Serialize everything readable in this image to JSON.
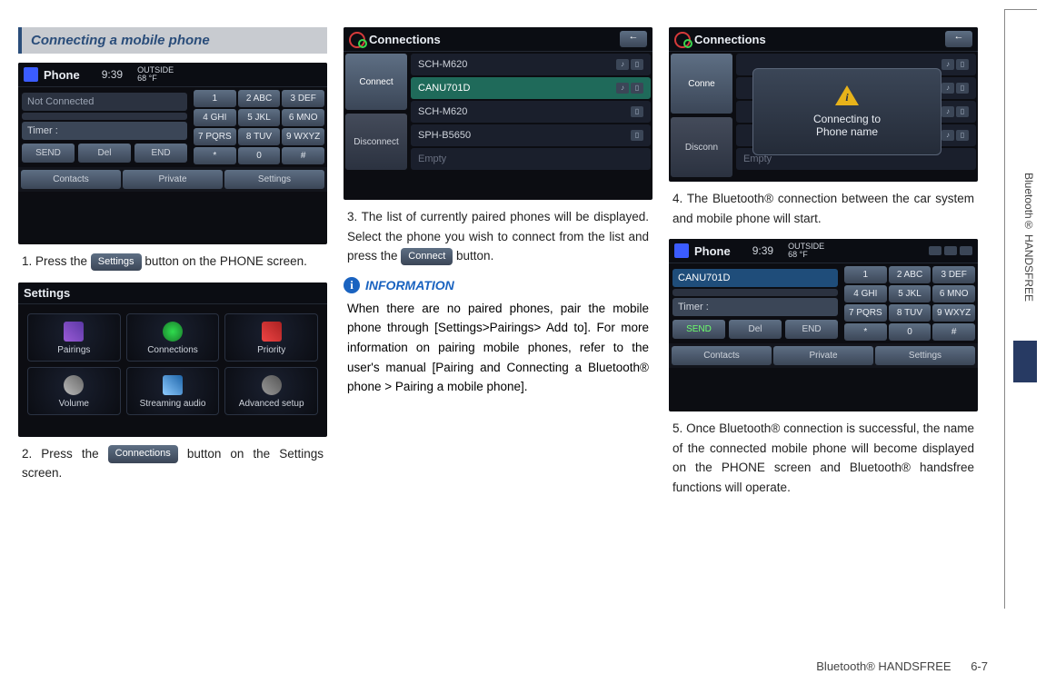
{
  "header": {
    "title": "Connecting a mobile phone"
  },
  "steps": {
    "s1a": "1. Press the ",
    "s1b": " button on the PHONE screen.",
    "s2a": "2. Press the ",
    "s2b": " button on the Settings screen.",
    "s3a": "3. The list of currently paired phones will be displayed. Select the phone you wish to connect from the list and press the ",
    "s3b": " button.",
    "s4": "4. The Bluetooth® connection between the car system and mobile phone will start.",
    "s5": "5. Once Bluetooth® connection is successful, the name of the connected mobile phone will become displayed on the PHONE screen and Bluetooth® handsfree functions will operate."
  },
  "chips": {
    "settings": "Settings",
    "connections": "Connections",
    "connect": "Connect"
  },
  "info": {
    "label": "INFORMATION",
    "icon": "i",
    "body": "When there are no paired phones, pair the mobile phone through [Settings>Pairings> Add to]. For more information on pairing mobile phones, refer to the user's manual [Pairing and Connecting a Bluetooth® phone > Pairing a mobile phone]."
  },
  "phoneScreen": {
    "title": "Phone",
    "time": "9:39",
    "tempTop": "OUTSIDE",
    "temp": "68 °F",
    "notConnected": "Not Connected",
    "timer": "Timer :",
    "keys": [
      "1",
      "2 ABC",
      "3 DEF",
      "4 GHI",
      "5 JKL",
      "6 MNO",
      "7 PQRS",
      "8 TUV",
      "9 WXYZ",
      "*",
      "0",
      "#"
    ],
    "send": "SEND",
    "del": "Del",
    "end": "END",
    "contacts": "Contacts",
    "private": "Private",
    "settings": "Settings"
  },
  "settingsScreen": {
    "title": "Settings",
    "items": [
      "Pairings",
      "Connections",
      "Priority",
      "Volume",
      "Streaming audio",
      "Advanced setup"
    ]
  },
  "connectionsScreen": {
    "title": "Connections",
    "back": "←",
    "side": [
      "Connect",
      "Disconnect"
    ],
    "rows": [
      "SCH-M620",
      "CANU701D",
      "SCH-M620",
      "SPH-B5650",
      "Empty"
    ]
  },
  "modalScreen": {
    "title": "Connections",
    "line1": "Connecting to",
    "line2": "Phone name",
    "side": [
      "Conne",
      "Disconn"
    ],
    "empty": "Empty"
  },
  "phoneConnected": {
    "title": "Phone",
    "time": "9:39",
    "tempTop": "OUTSIDE",
    "temp": "68 °F",
    "name": "CANU701D",
    "timer": "Timer :",
    "send": "SEND",
    "del": "Del",
    "end": "END",
    "contacts": "Contacts",
    "private": "Private",
    "settings": "Settings",
    "keys": [
      "1",
      "2 ABC",
      "3 DEF",
      "4 GHI",
      "5 JKL",
      "6 MNO",
      "7 PQRS",
      "8 TUV",
      "9 WXYZ",
      "*",
      "0",
      "#"
    ]
  },
  "sideLabel": "Bluetooth® HANDSFREE",
  "footer": {
    "text": "Bluetooth® HANDSFREE",
    "page": "6-7"
  }
}
